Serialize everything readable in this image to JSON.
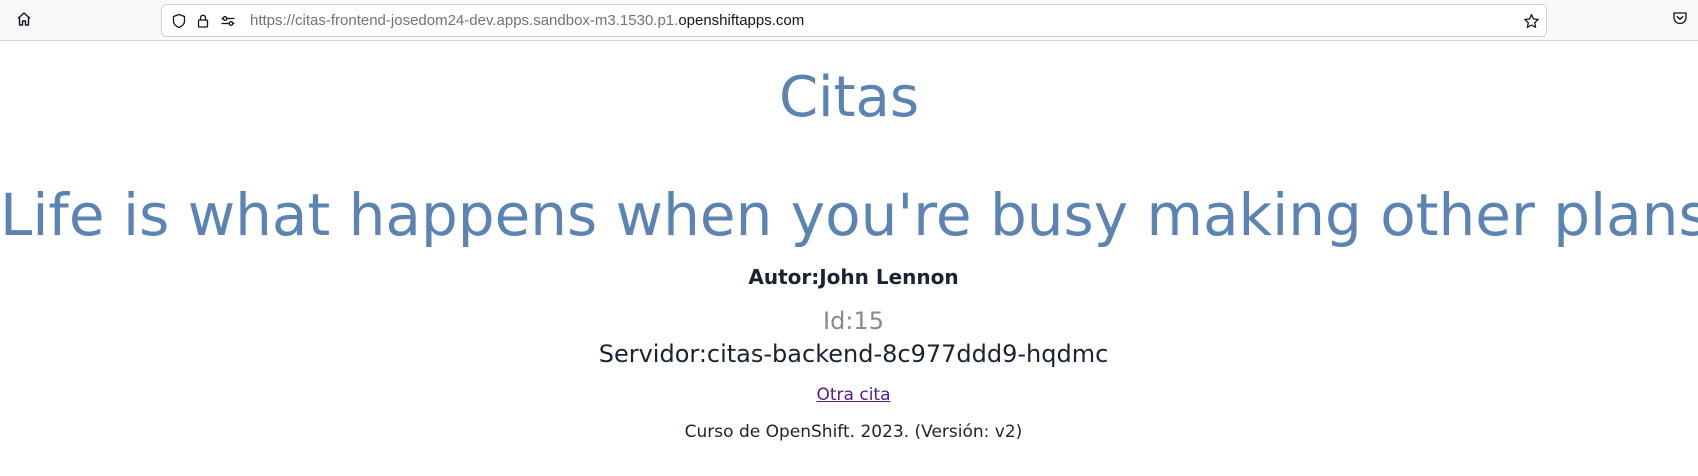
{
  "browser": {
    "url_prefix": "https://citas-frontend-josedom24-dev.apps.sandbox-m3.1530.p1.",
    "url_domain": "openshiftapps.com",
    "icons": [
      "home-icon",
      "shield-icon",
      "lock-icon",
      "permissions-icon",
      "bookmark-star-icon",
      "pocket-icon"
    ]
  },
  "page": {
    "title": "Citas",
    "quote": "Life is what happens when you're busy making other plans.",
    "author": "Autor:John Lennon",
    "id": "Id:15",
    "server": "Servidor:citas-backend-8c977ddd9-hqdmc",
    "link_label": "Otra cita",
    "footer": "Curso de OpenShift. 2023. (Versión: v2)"
  },
  "colors": {
    "heading": "#5b84b5",
    "text": "#1a2332",
    "muted": "#8a8a8a",
    "visited_link": "#551a8b"
  }
}
